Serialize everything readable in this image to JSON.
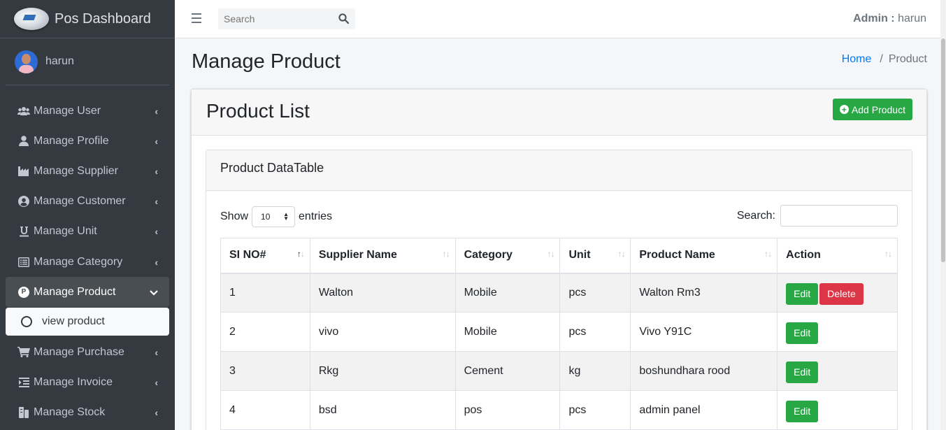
{
  "brand": {
    "title": "Pos Dashboard"
  },
  "user": {
    "name": "harun"
  },
  "sidebar": {
    "items": [
      {
        "label": "Manage User",
        "icon": "users-icon"
      },
      {
        "label": "Manage Profile",
        "icon": "user-icon"
      },
      {
        "label": "Manage Supplier",
        "icon": "industry-icon"
      },
      {
        "label": "Manage Customer",
        "icon": "user-circle-icon"
      },
      {
        "label": "Manage Unit",
        "icon": "underline-icon"
      },
      {
        "label": "Manage Category",
        "icon": "list-alt-icon"
      },
      {
        "label": "Manage Product",
        "icon": "product-badge-icon",
        "active": true
      },
      {
        "label": "Manage Purchase",
        "icon": "cart-icon"
      },
      {
        "label": "Manage Invoice",
        "icon": "indent-icon"
      },
      {
        "label": "Manage Stock",
        "icon": "boxes-icon"
      }
    ],
    "sub_item": {
      "label": "view product"
    }
  },
  "topbar": {
    "search_placeholder": "Search",
    "admin_prefix": "Admin :",
    "admin_name": "harun"
  },
  "header": {
    "title": "Manage Product",
    "breadcrumb": [
      "Home",
      "Product"
    ]
  },
  "card": {
    "title": "Product List",
    "add_button": "Add Product",
    "inner_title": "Product DataTable"
  },
  "datatable": {
    "show_label": "Show",
    "length_value": "10",
    "entries_label": "entries",
    "search_label": "Search:",
    "columns": [
      "SI NO#",
      "Supplier Name",
      "Category",
      "Unit",
      "Product Name",
      "Action"
    ],
    "rows": [
      {
        "si": "1",
        "supplier": "Walton",
        "category": "Mobile",
        "unit": "pcs",
        "product": "Walton Rm3",
        "actions": [
          "Edit",
          "Delete"
        ]
      },
      {
        "si": "2",
        "supplier": "vivo",
        "category": "Mobile",
        "unit": "pcs",
        "product": "Vivo Y91C",
        "actions": [
          "Edit"
        ]
      },
      {
        "si": "3",
        "supplier": "Rkg",
        "category": "Cement",
        "unit": "kg",
        "product": "boshundhara rood",
        "actions": [
          "Edit"
        ]
      },
      {
        "si": "4",
        "supplier": "bsd",
        "category": "pos",
        "unit": "pcs",
        "product": "admin panel",
        "actions": [
          "Edit"
        ]
      }
    ]
  },
  "colors": {
    "sidebar_bg": "#343a40",
    "accent_green": "#28a745",
    "danger_red": "#dc3545",
    "link_blue": "#007bff"
  }
}
